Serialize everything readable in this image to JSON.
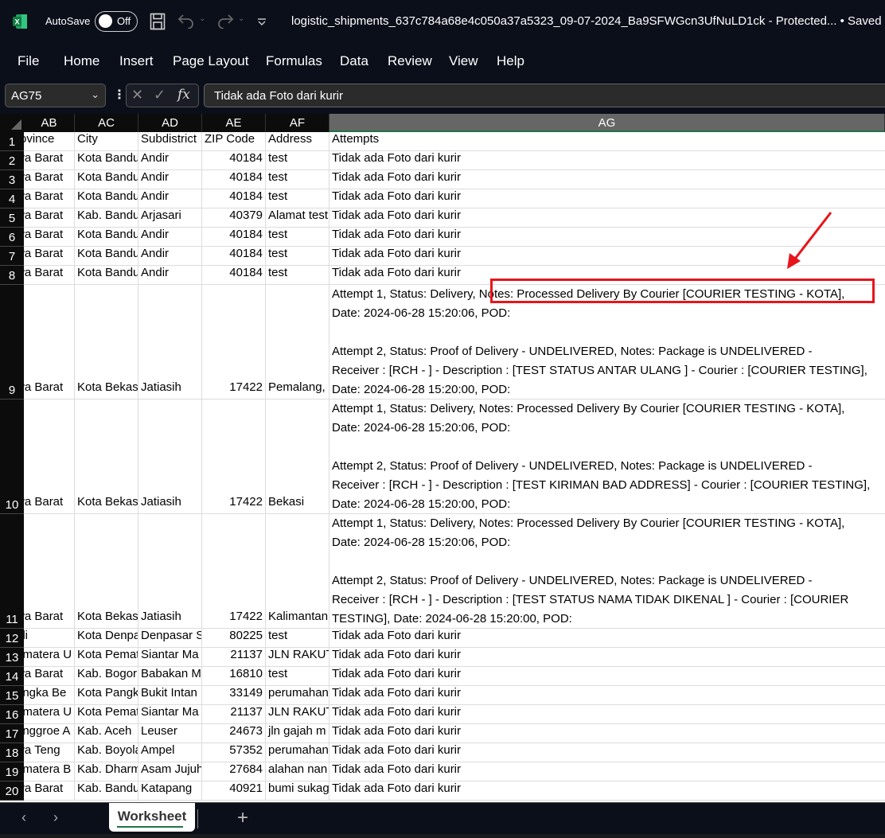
{
  "titlebar": {
    "autosave_label": "AutoSave",
    "autosave_state": "Off",
    "title": "logistic_shipments_637c784a68e4c050a37a5323_09-07-2024_Ba9SFWGcn3UfNuLD1ck  -  Protected...  • Saved to t"
  },
  "menu": [
    "File",
    "Home",
    "Insert",
    "Page Layout",
    "Formulas",
    "Data",
    "Review",
    "View",
    "Help"
  ],
  "formula_bar": {
    "name_box": "AG75",
    "formula": "Tidak ada Foto dari kurir"
  },
  "columns": [
    "AB",
    "AC",
    "AD",
    "AE",
    "AF",
    "AG"
  ],
  "selected_column": "AG",
  "rows": [
    {
      "n": "1",
      "cells": [
        "rovince",
        "City",
        "Subdistrict",
        "ZIP Code",
        "Address",
        "Attempts"
      ]
    },
    {
      "n": "2",
      "cells": [
        "wa Barat",
        "Kota Bandung",
        "Andir",
        "40184",
        "test",
        "Tidak ada Foto dari kurir"
      ]
    },
    {
      "n": "3",
      "cells": [
        "wa Barat",
        "Kota Bandung",
        "Andir",
        "40184",
        "test",
        "Tidak ada Foto dari kurir"
      ]
    },
    {
      "n": "4",
      "cells": [
        "wa Barat",
        "Kota Bandung",
        "Andir",
        "40184",
        "test",
        "Tidak ada Foto dari kurir"
      ]
    },
    {
      "n": "5",
      "cells": [
        "wa Barat",
        "Kab. Bandung",
        "Arjasari",
        "40379",
        "Alamat test",
        "Tidak ada Foto dari kurir"
      ]
    },
    {
      "n": "6",
      "cells": [
        "wa Barat",
        "Kota Bandung",
        "Andir",
        "40184",
        "test",
        "Tidak ada Foto dari kurir"
      ]
    },
    {
      "n": "7",
      "cells": [
        "wa Barat",
        "Kota Bandung",
        "Andir",
        "40184",
        "test",
        "Tidak ada Foto dari kurir"
      ]
    },
    {
      "n": "8",
      "cells": [
        "wa Barat",
        "Kota Bandung",
        "Andir",
        "40184",
        "test",
        "Tidak ada Foto dari kurir"
      ]
    },
    {
      "n": "9",
      "tall": true,
      "cells": [
        "wa Barat",
        "Kota Bekasi",
        "Jatiasih",
        "17422",
        "Pemalang,",
        "Attempt 1, Status: Delivery, Notes: Processed Delivery By Courier [COURIER TESTING - KOTA],\nDate: 2024-06-28 15:20:06, POD:\n\nAttempt 2, Status: Proof of Delivery - UNDELIVERED, Notes: Package is UNDELIVERED -\nReceiver : [RCH - ] - Description : [TEST STATUS ANTAR ULANG ] - Courier : [COURIER TESTING],\nDate: 2024-06-28 15:20:00, POD:"
      ]
    },
    {
      "n": "10",
      "tall": true,
      "cells": [
        "wa Barat",
        "Kota Bekasi",
        "Jatiasih",
        "17422",
        "Bekasi",
        "Attempt 1, Status: Delivery, Notes: Processed Delivery By Courier [COURIER TESTING - KOTA],\nDate: 2024-06-28 15:20:06, POD:\n\nAttempt 2, Status: Proof of Delivery - UNDELIVERED, Notes: Package is UNDELIVERED -\nReceiver : [RCH - ] - Description : [TEST KIRIMAN BAD ADDRESS] - Courier : [COURIER TESTING],\nDate: 2024-06-28 15:20:00, POD:"
      ]
    },
    {
      "n": "11",
      "tall": true,
      "cells": [
        "wa Barat",
        "Kota Bekasi",
        "Jatiasih",
        "17422",
        "Kalimantan",
        "Attempt 1, Status: Delivery, Notes: Processed Delivery By Courier [COURIER TESTING - KOTA],\nDate: 2024-06-28 15:20:06, POD:\n\nAttempt 2, Status: Proof of Delivery - UNDELIVERED, Notes: Package is UNDELIVERED -\nReceiver : [RCH - ] - Description : [TEST STATUS NAMA TIDAK DIKENAL ] - Courier : [COURIER\nTESTING], Date: 2024-06-28 15:20:00, POD:"
      ]
    },
    {
      "n": "12",
      "cells": [
        "ali",
        "Kota Denpasar",
        "Denpasar S",
        "80225",
        "test",
        "Tidak ada Foto dari kurir"
      ]
    },
    {
      "n": "13",
      "cells": [
        "umatera U",
        "Kota Pematang",
        "Siantar Ma",
        "21137",
        "JLN RAKUT",
        "Tidak ada Foto dari kurir"
      ]
    },
    {
      "n": "14",
      "cells": [
        "wa Barat",
        "Kab. Bogor",
        "Babakan M",
        "16810",
        "test",
        "Tidak ada Foto dari kurir"
      ]
    },
    {
      "n": "15",
      "cells": [
        "angka Be",
        "Kota Pangkal",
        "Bukit Intan",
        "33149",
        "perumahan",
        "Tidak ada Foto dari kurir"
      ]
    },
    {
      "n": "16",
      "cells": [
        "umatera U",
        "Kota Pematang",
        "Siantar Ma",
        "21137",
        "JLN RAKUT",
        "Tidak ada Foto dari kurir"
      ]
    },
    {
      "n": "17",
      "cells": [
        "anggroe A",
        "Kab. Aceh",
        "Leuser",
        "24673",
        "jln gajah m",
        "Tidak ada Foto dari kurir"
      ]
    },
    {
      "n": "18",
      "cells": [
        "wa Teng",
        "Kab. Boyolali",
        "Ampel",
        "57352",
        "perumahan",
        "Tidak ada Foto dari kurir"
      ]
    },
    {
      "n": "19",
      "cells": [
        "umatera B",
        "Kab. Dharmasraya",
        "Asam Jujuh",
        "27684",
        "alahan nan",
        "Tidak ada Foto dari kurir"
      ]
    },
    {
      "n": "20",
      "cells": [
        "wa Barat",
        "Kab. Bandung",
        "Katapang",
        "40921",
        "bumi sukag",
        "Tidak ada Foto dari kurir"
      ]
    }
  ],
  "annotation": {
    "highlighted_text": "Notes: Processed Delivery By Courier [COURIER TESTING - KOTA]",
    "color": "#e8141b"
  },
  "sheet_tabs": {
    "active": "Worksheet",
    "add_label": "+"
  },
  "colors": {
    "excel_green": "#217346",
    "dark_bg": "#0b0f1a"
  }
}
